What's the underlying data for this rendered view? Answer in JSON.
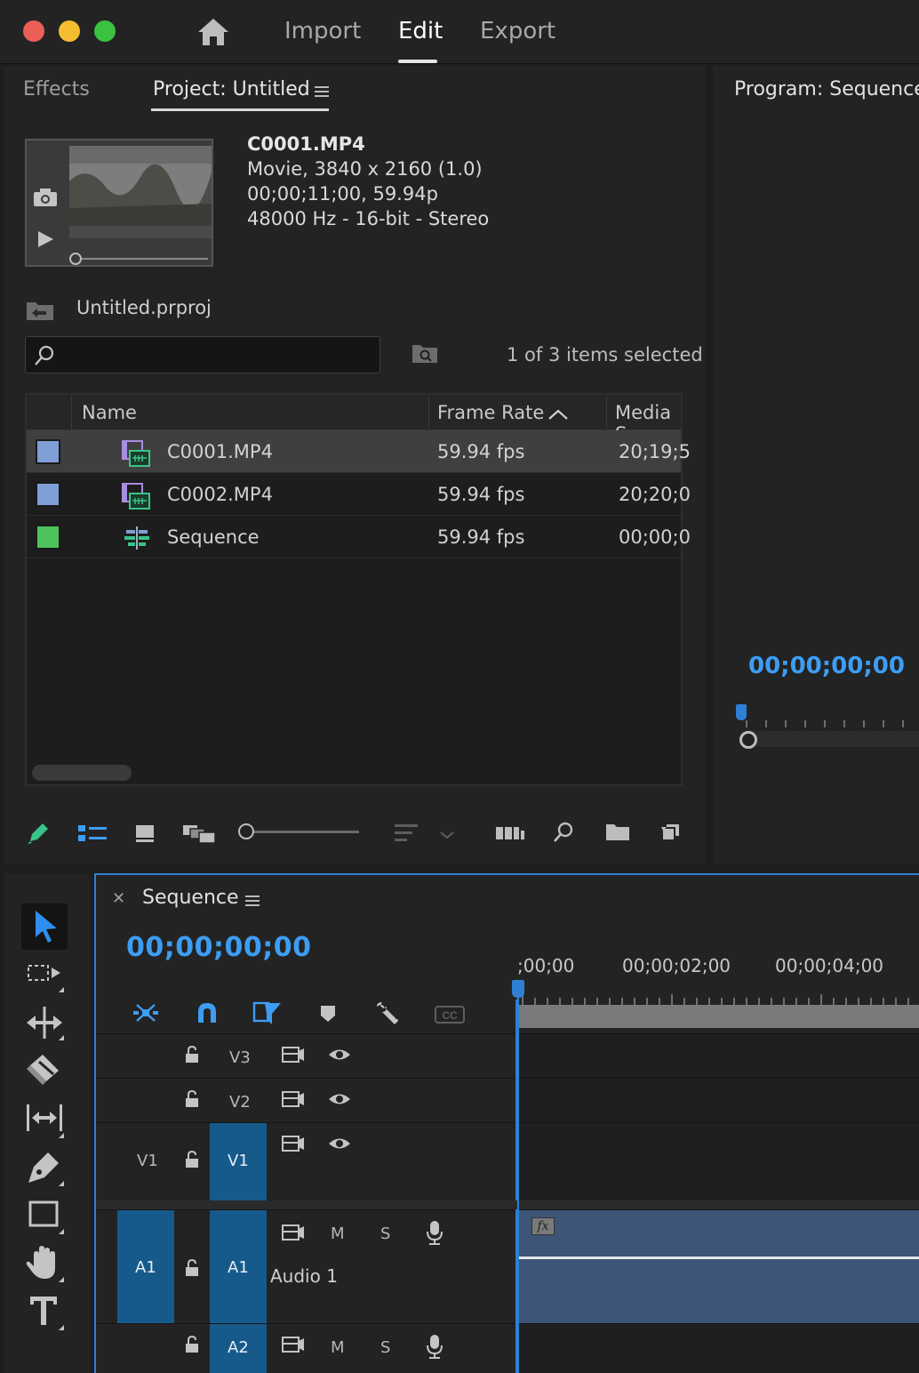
{
  "window": {
    "traffic_lights": [
      "#ec5f57",
      "#f5bd30",
      "#3cc241"
    ]
  },
  "top_nav": {
    "items": [
      {
        "label": "Import",
        "active": false
      },
      {
        "label": "Edit",
        "active": true
      },
      {
        "label": "Export",
        "active": false
      }
    ]
  },
  "project_panel": {
    "tabs": [
      {
        "label": "Effects"
      },
      {
        "label": "Project: Untitled"
      }
    ],
    "preview": {
      "clip_name": "C0001.MP4",
      "line1": "Movie, 3840 x 2160 (1.0)",
      "line2": "00;00;11;00, 59.94p",
      "line3": "48000 Hz - 16-bit - Stereo"
    },
    "project_file": "Untitled.prproj",
    "search_placeholder": "",
    "items_selected": "1 of 3 items selected",
    "columns": [
      "Name",
      "Frame Rate",
      "Media S"
    ],
    "rows": [
      {
        "name": "C0001.MP4",
        "frame_rate": "59.94 fps",
        "media": "20;19;5",
        "color": "#7f9ed6",
        "icon": "video-clip-icon",
        "selected": true
      },
      {
        "name": "C0002.MP4",
        "frame_rate": "59.94 fps",
        "media": "20;20;0",
        "color": "#7f9ed6",
        "icon": "video-clip-icon",
        "selected": false
      },
      {
        "name": "Sequence",
        "frame_rate": "59.94 fps",
        "media": "00;00;0",
        "color": "#4ec25a",
        "icon": "sequence-icon",
        "selected": false
      }
    ]
  },
  "program_monitor": {
    "title": "Program: Sequence",
    "timecode": "00;00;00;00"
  },
  "timeline": {
    "title": "Sequence",
    "timecode": "00;00;00;00",
    "ruler_labels": [
      ";00;00",
      "00;00;02;00",
      "00;00;04;00"
    ],
    "tracks": {
      "v3": "V3",
      "v2": "V2",
      "v1_source": "V1",
      "v1": "V1",
      "a1_source": "A1",
      "a1": "A1",
      "a1_name": "Audio 1",
      "a2": "A2",
      "mute": "M",
      "solo": "S"
    },
    "fx_badge": "fx"
  },
  "colors": {
    "accent_blue": "#3d9df3",
    "target_blue": "#165a8c",
    "audio_clip": "#3d5577"
  }
}
